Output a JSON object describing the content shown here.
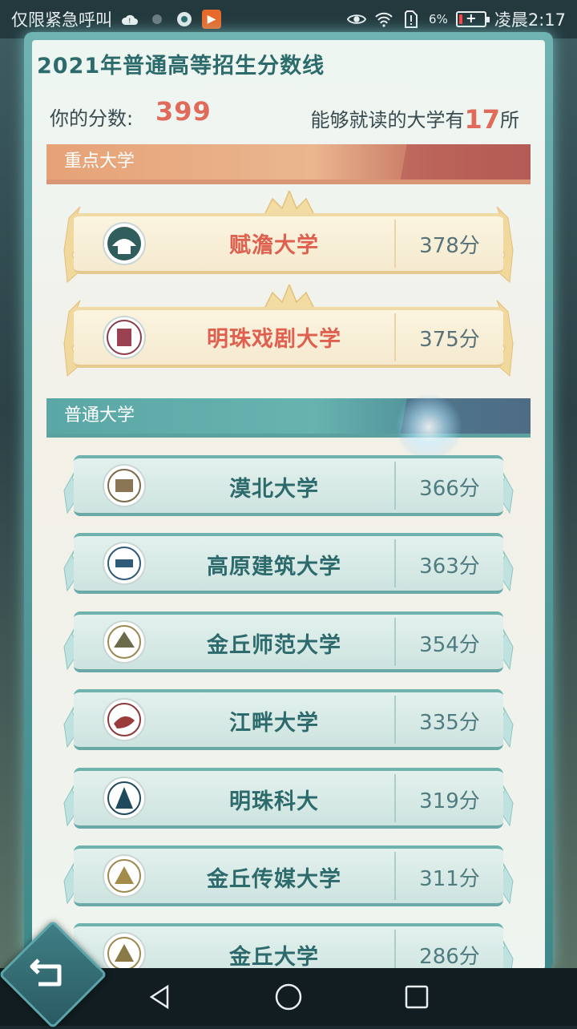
{
  "status_bar": {
    "carrier_text": "仅限紧急呼叫",
    "battery_percent": "6%",
    "time": "凌晨2:17",
    "icons": [
      "cloud-icon",
      "dot-icon",
      "app-icon",
      "video-app-icon",
      "eye-icon",
      "wifi-icon",
      "sim-alert-icon",
      "battery-charging-icon"
    ]
  },
  "page": {
    "title": "2021年普通高等招生分数线",
    "score_label": "你的分数:",
    "score_value": "399",
    "attend_prefix": "能够就读的大学有",
    "attend_count": "17",
    "attend_suffix": "所"
  },
  "sections": {
    "key": {
      "title": "重点大学",
      "universities": [
        {
          "name": "赋澹大学",
          "score": "378分"
        },
        {
          "name": "明珠戏剧大学",
          "score": "375分"
        }
      ]
    },
    "normal": {
      "title": "普通大学",
      "universities": [
        {
          "name": "漠北大学",
          "score": "366分"
        },
        {
          "name": "高原建筑大学",
          "score": "363分"
        },
        {
          "name": "金丘师范大学",
          "score": "354分"
        },
        {
          "name": "江畔大学",
          "score": "335分"
        },
        {
          "name": "明珠科大",
          "score": "319分"
        },
        {
          "name": "金丘传媒大学",
          "score": "311分"
        },
        {
          "name": "金丘大学",
          "score": "286分"
        }
      ]
    }
  },
  "colors": {
    "accent_red": "#e06b5a",
    "teal": "#2d6a6c",
    "key_header": "#e6a277",
    "normal_header": "#5aa7a6"
  },
  "nav_bar": {
    "icons": [
      "back-triangle-icon",
      "home-circle-icon",
      "recents-square-icon"
    ]
  }
}
